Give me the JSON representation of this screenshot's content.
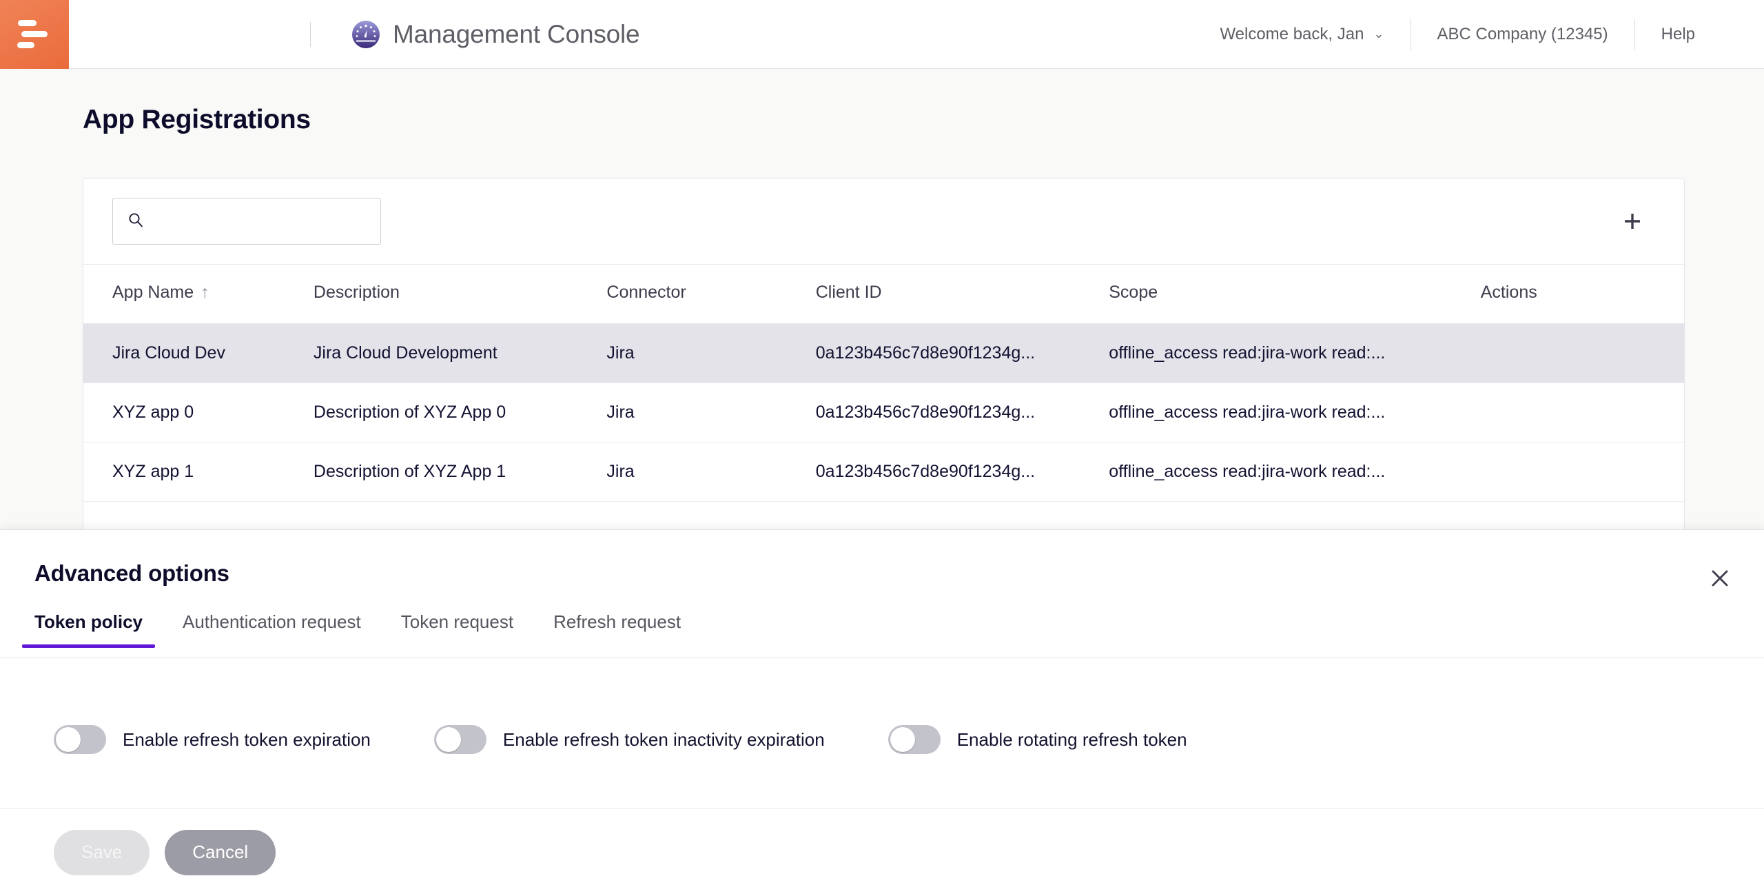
{
  "topbar": {
    "menu_icon": "hamburger-icon",
    "logo_icon": "gauge-logo-icon",
    "title": "Management Console",
    "welcome": "Welcome back, Jan",
    "caret": "⌄",
    "company": "ABC Company (12345)",
    "help": "Help"
  },
  "page": {
    "title": "App Registrations"
  },
  "toolbar": {
    "search_placeholder": "",
    "search_value": "",
    "search_icon": "search-icon",
    "add_icon": "plus-icon"
  },
  "table": {
    "columns": [
      "App Name",
      "Description",
      "Connector",
      "Client ID",
      "Scope",
      "Actions"
    ],
    "sort_column": "App Name",
    "sort_arrow": "↑",
    "rows": [
      {
        "app_name": "Jira Cloud Dev",
        "description": "Jira Cloud Development",
        "connector": "Jira",
        "client_id": "0a123b456c7d8e90f1234g...",
        "scope": "offline_access read:jira-work read:...",
        "actions": "",
        "selected": true
      },
      {
        "app_name": "XYZ app 0",
        "description": "Description of XYZ App 0",
        "connector": "Jira",
        "client_id": "0a123b456c7d8e90f1234g...",
        "scope": "offline_access read:jira-work read:...",
        "actions": "",
        "selected": false
      },
      {
        "app_name": "XYZ app 1",
        "description": "Description of XYZ App 1",
        "connector": "Jira",
        "client_id": "0a123b456c7d8e90f1234g...",
        "scope": "offline_access read:jira-work read:...",
        "actions": "",
        "selected": false
      }
    ]
  },
  "panel": {
    "title": "Advanced options",
    "close_icon": "close-icon",
    "tabs": [
      {
        "label": "Token policy",
        "active": true
      },
      {
        "label": "Authentication request",
        "active": false
      },
      {
        "label": "Token request",
        "active": false
      },
      {
        "label": "Refresh request",
        "active": false
      }
    ],
    "toggles": [
      {
        "label": "Enable refresh token expiration",
        "on": false
      },
      {
        "label": "Enable refresh token inactivity expiration",
        "on": false
      },
      {
        "label": "Enable rotating refresh token",
        "on": false
      }
    ],
    "save_label": "Save",
    "cancel_label": "Cancel"
  },
  "colors": {
    "accent_orange": "#ea6b3c",
    "accent_purple": "#6118d4",
    "row_selected": "#e3e3e9",
    "text_dark": "#0d0d2b"
  }
}
